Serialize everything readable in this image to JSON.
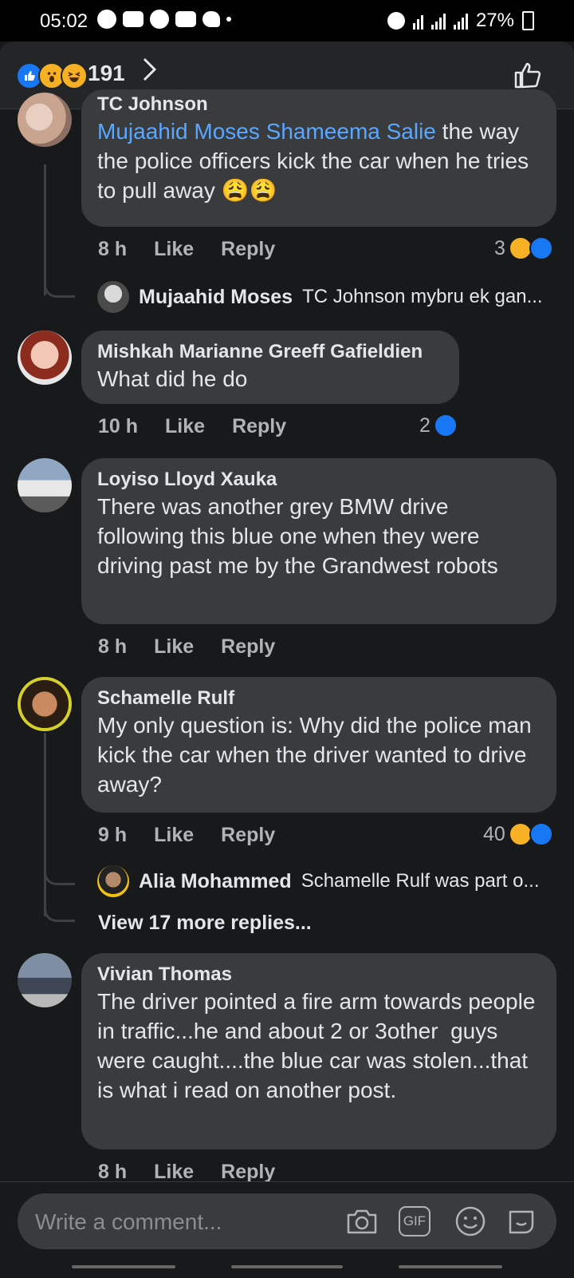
{
  "status_bar": {
    "time": "05:02",
    "battery": "27%"
  },
  "reactions_header": {
    "count": "191"
  },
  "comments": [
    {
      "name": "TC Johnson",
      "mention": "Mujaahid Moses Shameema Salie",
      "text": " the way the police officers kick the car when he tries to pull away 😩😩",
      "time": "8 h",
      "like": "Like",
      "reply": "Reply",
      "reaction_count": "3",
      "reply_preview": {
        "name": "Mujaahid Moses",
        "text": "TC Johnson mybru ek gan..."
      }
    },
    {
      "name": "Mishkah Marianne Greeff Gafieldien",
      "text": "What did he do",
      "time": "10 h",
      "like": "Like",
      "reply": "Reply",
      "reaction_count": "2"
    },
    {
      "name": "Loyiso Lloyd Xauka",
      "text": "There was another grey BMW drive following this blue one when they were driving past me by the Grandwest robots",
      "time": "8 h",
      "like": "Like",
      "reply": "Reply"
    },
    {
      "name": "Schamelle Rulf",
      "text": "My only question is: Why did the police man kick the car when the driver wanted to drive away?",
      "time": "9 h",
      "like": "Like",
      "reply": "Reply",
      "reaction_count": "40",
      "reply_preview": {
        "name": "Alia Mohammed",
        "text": "Schamelle Rulf was part o..."
      },
      "view_more": "View 17 more replies..."
    },
    {
      "name": "Vivian Thomas",
      "text": "The driver pointed a fire arm towards people in traffic...he and about 2 or 3other  guys were caught....the blue car was stolen...that is what i read on another post.",
      "time": "8 h",
      "like": "Like",
      "reply": "Reply"
    }
  ],
  "composer": {
    "placeholder": "Write a comment...",
    "gif_label": "GIF"
  },
  "colors": {
    "background": "#18191a",
    "bubble": "#3a3b3c",
    "mention": "#5aa7ff",
    "like_blue": "#1877f2",
    "haha_yellow": "#f7b125"
  }
}
